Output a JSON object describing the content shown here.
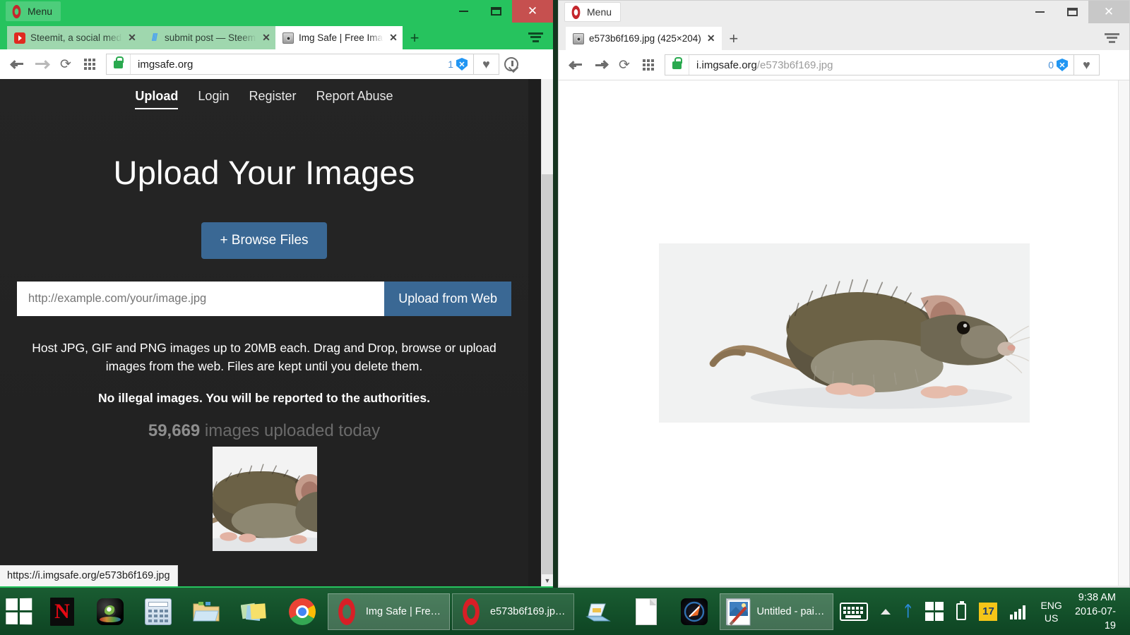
{
  "left_window": {
    "menu_label": "Menu",
    "controls": {
      "minimize": "minimize",
      "maximize": "maximize",
      "close": "close"
    },
    "tabs": [
      {
        "title": "Steemit, a social media",
        "favicon": "youtube-icon",
        "active": false
      },
      {
        "title": "submit post — Steemit",
        "favicon": "steem-icon",
        "active": false
      },
      {
        "title": "Img Safe | Free Image",
        "favicon": "imgsafe-icon",
        "active": true
      }
    ],
    "new_tab_label": "+",
    "toolbar": {
      "back": "back-arrow",
      "forward": "forward-arrow",
      "reload": "⟳",
      "speed_dial": "grid-icon",
      "security": "secure-lock",
      "url": "imgsafe.org",
      "blocked_count": "1",
      "shield_label": "✕",
      "heart": "♥",
      "download": "download-icon",
      "battery": "battery-icon"
    },
    "page": {
      "nav": [
        {
          "label": "Upload",
          "selected": true
        },
        {
          "label": "Login",
          "selected": false
        },
        {
          "label": "Register",
          "selected": false
        },
        {
          "label": "Report Abuse",
          "selected": false
        }
      ],
      "heading": "Upload Your Images",
      "browse_button": "+ Browse Files",
      "url_placeholder": "http://example.com/your/image.jpg",
      "url_value": "",
      "upload_web_button": "Upload from Web",
      "blurb": "Host JPG, GIF and PNG images up to 20MB each. Drag and Drop, browse or upload images from the web. Files are kept until you delete them.",
      "warning": "No illegal images. You will be reported to the authorities.",
      "counter_number": "59,669",
      "counter_suffix": " images uploaded today"
    },
    "status_url": "https://i.imgsafe.org/e573b6f169.jpg"
  },
  "right_window": {
    "menu_label": "Menu",
    "tabs": [
      {
        "title": "e573b6f169.jpg (425×204)",
        "favicon": "imgsafe-icon",
        "active": true
      }
    ],
    "new_tab_label": "+",
    "toolbar": {
      "url_host": "i.imgsafe.org",
      "url_path": "/e573b6f169.jpg",
      "blocked_count": "0",
      "shield_label": "✕",
      "heart": "♥"
    },
    "image_alt": "brown rat photo on white background"
  },
  "taskbar": {
    "start_label": "Start",
    "quick_launch": [
      {
        "name": "netflix-icon"
      },
      {
        "name": "camera-icon"
      },
      {
        "name": "calculator-icon"
      },
      {
        "name": "file-explorer-icon"
      },
      {
        "name": "sticky-notes-icon"
      },
      {
        "name": "chrome-icon"
      }
    ],
    "tasks": [
      {
        "label": "Img Safe | Fre…",
        "icon": "opera-icon",
        "active": true
      },
      {
        "label": "e573b6f169.jp…",
        "icon": "opera-icon",
        "active": false
      }
    ],
    "extra_icons": [
      {
        "name": "scanner-icon"
      },
      {
        "name": "document-icon"
      },
      {
        "name": "foobar-icon"
      }
    ],
    "paint_task": {
      "label": "Untitled - pai…",
      "icon": "paint-icon"
    },
    "tray": {
      "keyboard": "keyboard-icon",
      "show_hidden": "chevron-up-icon",
      "bluetooth": "bluetooth-icon",
      "action_center": "windows-icon",
      "battery": "battery-icon",
      "calendar_day": "17",
      "network": "signal-icon",
      "language_line1": "ENG",
      "language_line2": "US",
      "time": "9:38 AM",
      "date": "2016-07-19"
    }
  },
  "colors": {
    "opera_green": "#26c35e",
    "close_red": "#c6504f",
    "page_dark": "#252525",
    "accent_blue": "#3a6894",
    "taskbar_green": "#14522b",
    "shield_blue": "#2196f3"
  }
}
